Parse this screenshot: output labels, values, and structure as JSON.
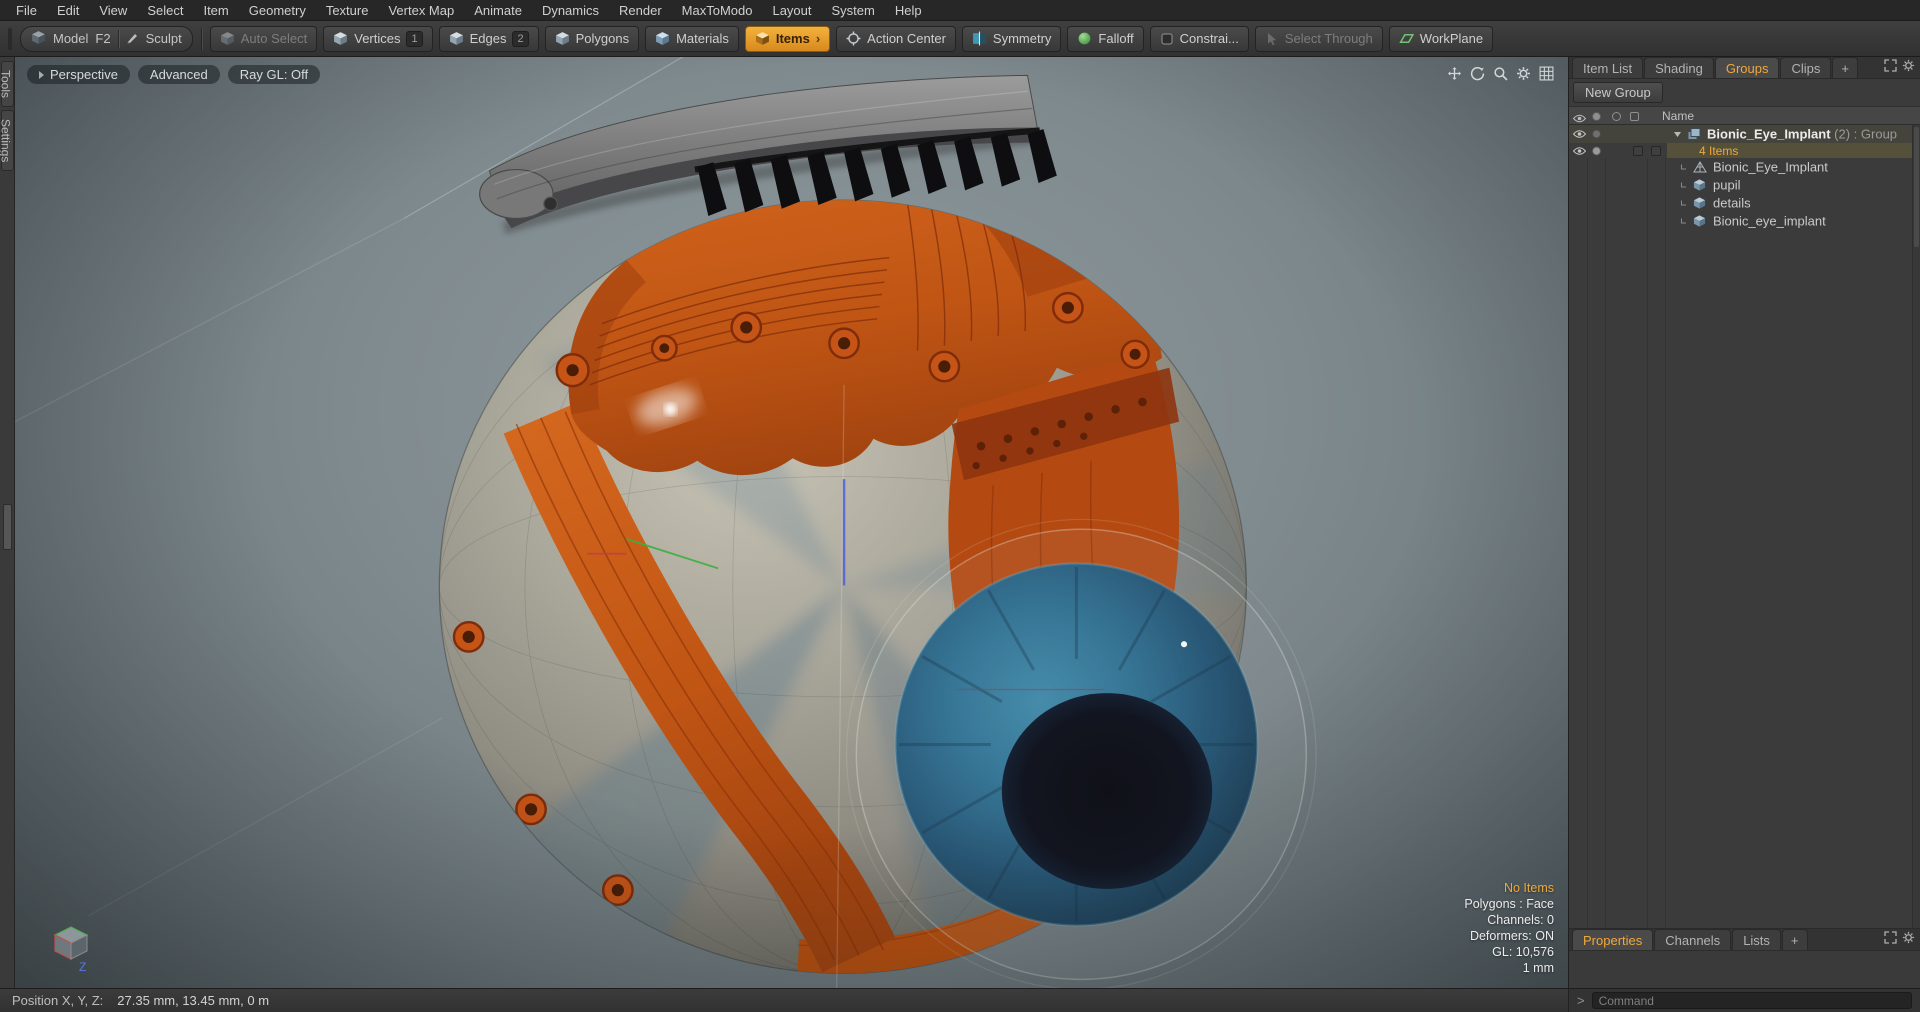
{
  "colors": {
    "accent": "#f0a83c",
    "implant_orange": "#c65417",
    "viewport_bg": "#7f8a8e",
    "iris_blue": "#2a6d90"
  },
  "menu": {
    "items": [
      "File",
      "Edit",
      "View",
      "Select",
      "Item",
      "Geometry",
      "Texture",
      "Vertex Map",
      "Animate",
      "Dynamics",
      "Render",
      "MaxToModo",
      "Layout",
      "System",
      "Help"
    ]
  },
  "toolbar": {
    "model": "Model",
    "model_shortcut": "F2",
    "sculpt": "Sculpt",
    "auto_select": "Auto Select",
    "vertices": "Vertices",
    "vertices_num": "1",
    "edges": "Edges",
    "edges_num": "2",
    "polygons": "Polygons",
    "materials": "Materials",
    "items": "Items",
    "items_chevron": "›",
    "action_center": "Action Center",
    "symmetry": "Symmetry",
    "falloff": "Falloff",
    "constraints": "Constrai...",
    "select_through": "Select Through",
    "workplane": "WorkPlane"
  },
  "left_tabs": {
    "tools": "Tools",
    "settings": "Settings"
  },
  "viewport": {
    "mode": "Perspective",
    "shading": "Advanced",
    "raygl": "Ray GL: Off",
    "info_no_items": "No Items",
    "info_polygons": "Polygons : Face",
    "info_channels": "Channels: 0",
    "info_deformers": "Deformers: ON",
    "info_gl": "GL: 10,576",
    "info_scale": "1 mm",
    "axis_label": "Z"
  },
  "right_panel": {
    "tab_item_list": "Item List",
    "tab_shading": "Shading",
    "tab_groups": "Groups",
    "tab_clips": "Clips",
    "tab_add": "+",
    "new_group": "New Group",
    "name_header": "Name",
    "group_label": "Bionic_Eye_Implant",
    "group_suffix": "(2) : Group",
    "items_count": "4 Items",
    "child_1": "Bionic_Eye_Implant",
    "child_2": "pupil",
    "child_3": "details",
    "child_4": "Bionic_eye_implant",
    "btab_properties": "Properties",
    "btab_channels": "Channels",
    "btab_lists": "Lists",
    "btab_add": "+"
  },
  "command": {
    "prompt": ">",
    "placeholder": "Command"
  },
  "status": {
    "label": "Position X, Y, Z:",
    "value": "27.35 mm, 13.45 mm, 0 m"
  }
}
